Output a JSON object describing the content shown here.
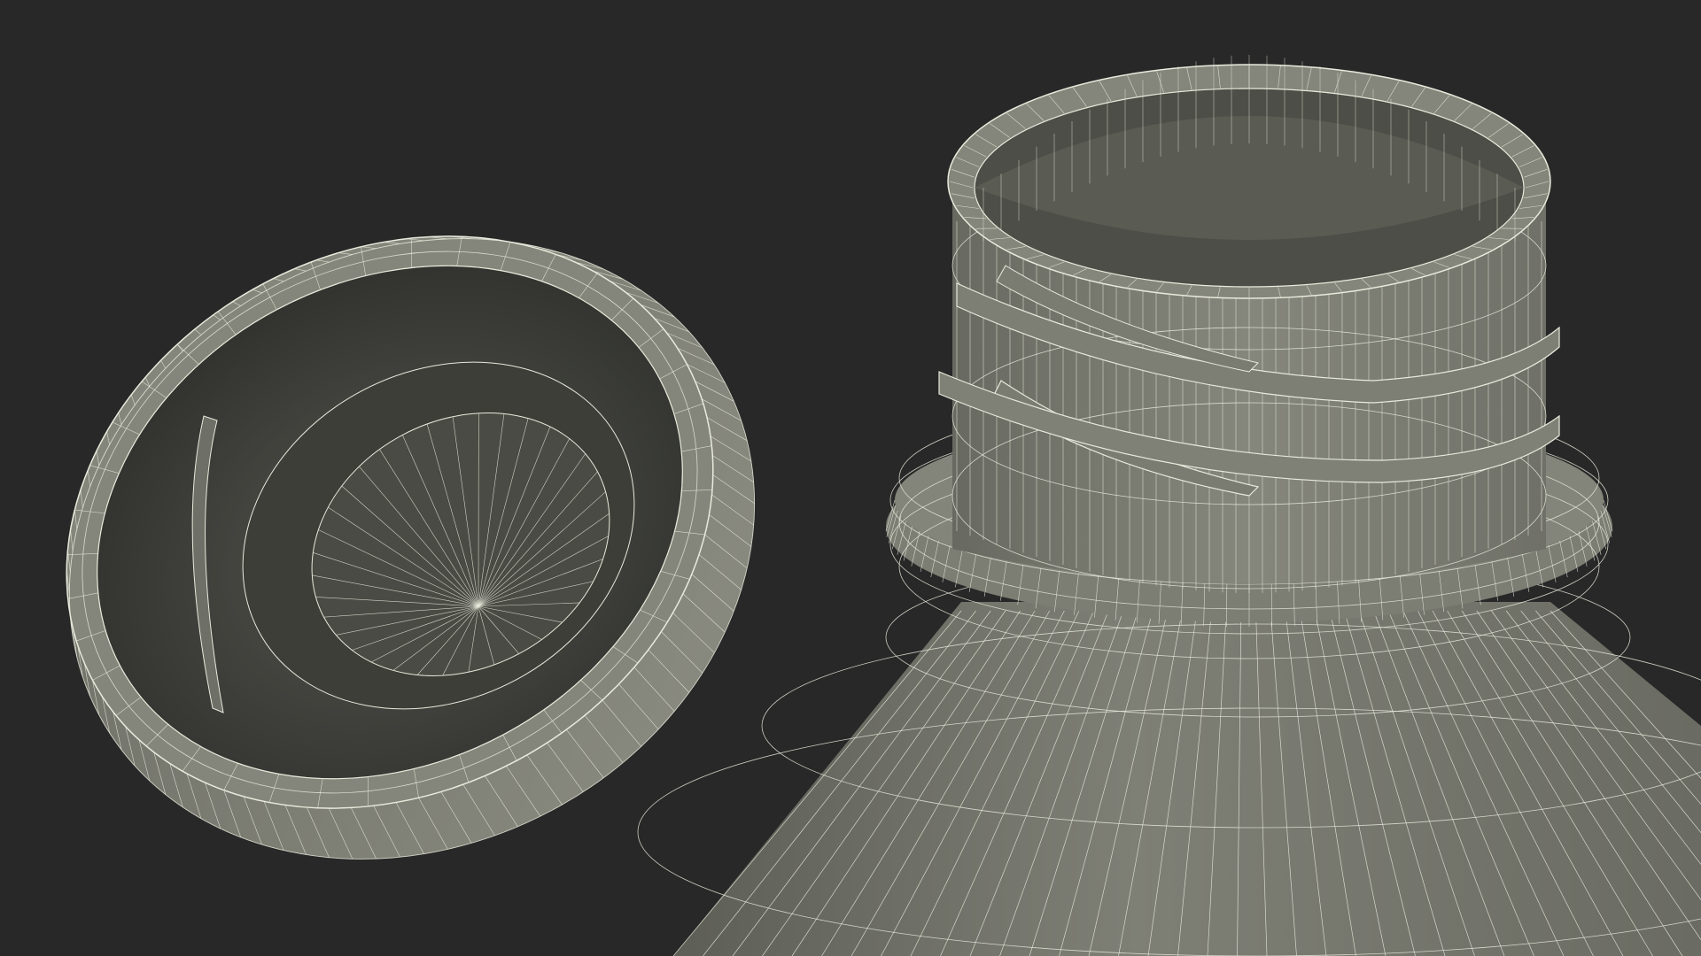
{
  "scene": {
    "background": "#282828",
    "surface_light": "#8a8b7f",
    "surface_mid": "#72736a",
    "surface_dark": "#4a4b44",
    "surface_deep": "#33342f",
    "wire": "#e8eadc",
    "objects": [
      "bottle-cap-icon",
      "bottle-neck-icon"
    ]
  }
}
